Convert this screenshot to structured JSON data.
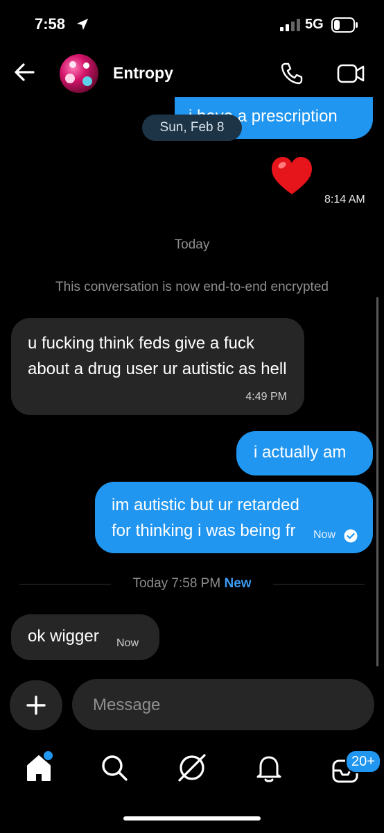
{
  "status_bar": {
    "time": "7:58",
    "network": "5G"
  },
  "header": {
    "contact_name": "Entropy"
  },
  "messages": {
    "top_bubble_text": "i have a prescription",
    "date_pill": "Sun, Feb 8",
    "heart_time": "8:14 AM",
    "today_label": "Today",
    "encryption_notice": "This conversation is now end-to-end encrypted",
    "incoming_1": {
      "text": "u fucking think feds give a fuck about a drug user ur autistic as hell",
      "time": "4:49 PM"
    },
    "outgoing_1": {
      "text": "i actually am"
    },
    "outgoing_2": {
      "text": "im autistic but ur retarded for thinking i was being fr",
      "time": "Now"
    },
    "divider": {
      "label": "Today 7:58 PM",
      "new_label": "New"
    },
    "incoming_2": {
      "text": "ok wigger",
      "time": "Now"
    }
  },
  "composer": {
    "placeholder": "Message"
  },
  "tab_bar": {
    "items": [
      "home-icon",
      "search-icon",
      "explore-icon",
      "notifications-icon",
      "inbox-icon"
    ],
    "inbox_badge": "20+"
  },
  "colors": {
    "accent": "#2196f0",
    "incoming_bubble": "#262626",
    "background": "#000000"
  }
}
